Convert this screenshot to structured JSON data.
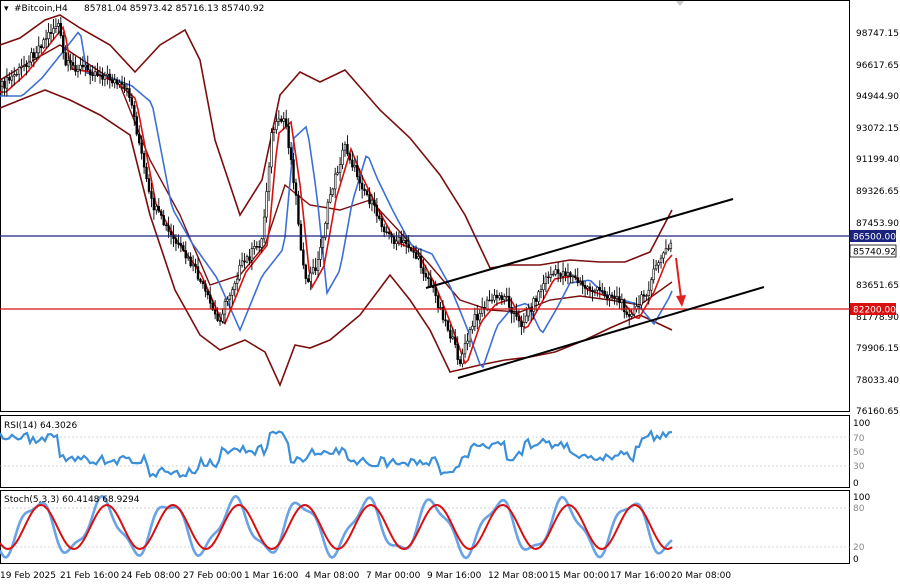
{
  "header": {
    "symbol": "#Bitcoin,H4",
    "ohlc": "85781.04 85973.42 85716.13 85740.92"
  },
  "main_price_axis": {
    "labels": [
      "98747.15",
      "96617.65",
      "94944.90",
      "93072.15",
      "91199.40",
      "89326.65",
      "87453.90",
      "83651.65",
      "81778.90",
      "79906.15",
      "78033.40",
      "76160.65"
    ]
  },
  "price_tags": {
    "blue_level": "86500.00",
    "current": "85740.92",
    "red_level": "82200.00"
  },
  "time_axis": {
    "labels": [
      "19 Feb 2025",
      "21 Feb 16:00",
      "24 Feb 08:00",
      "27 Feb 00:00",
      "1 Mar 16:00",
      "4 Mar 08:00",
      "7 Mar 00:00",
      "9 Mar 16:00",
      "12 Mar 08:00",
      "15 Mar 00:00",
      "17 Mar 16:00",
      "20 Mar 08:00"
    ]
  },
  "rsi_panel": {
    "label": "RSI(14) 64.3026",
    "axis_labels": [
      "100",
      "70",
      "50",
      "30",
      "0"
    ]
  },
  "stoch_panel": {
    "label": "Stoch(5,3,3) 60.4148 68.9294",
    "axis_labels": [
      "100",
      "80",
      "20",
      "0"
    ]
  },
  "colors": {
    "bollinger": "#7a0d0d",
    "ma_fast": "#d81010",
    "ma_slow": "#3d6fd6",
    "rsi_line": "#3a8fd8",
    "stoch_main": "#6aa2e6",
    "stoch_signal": "#d81010",
    "blue_level": "#1a237e",
    "red_level": "#d81010",
    "candle": "#000000"
  }
}
